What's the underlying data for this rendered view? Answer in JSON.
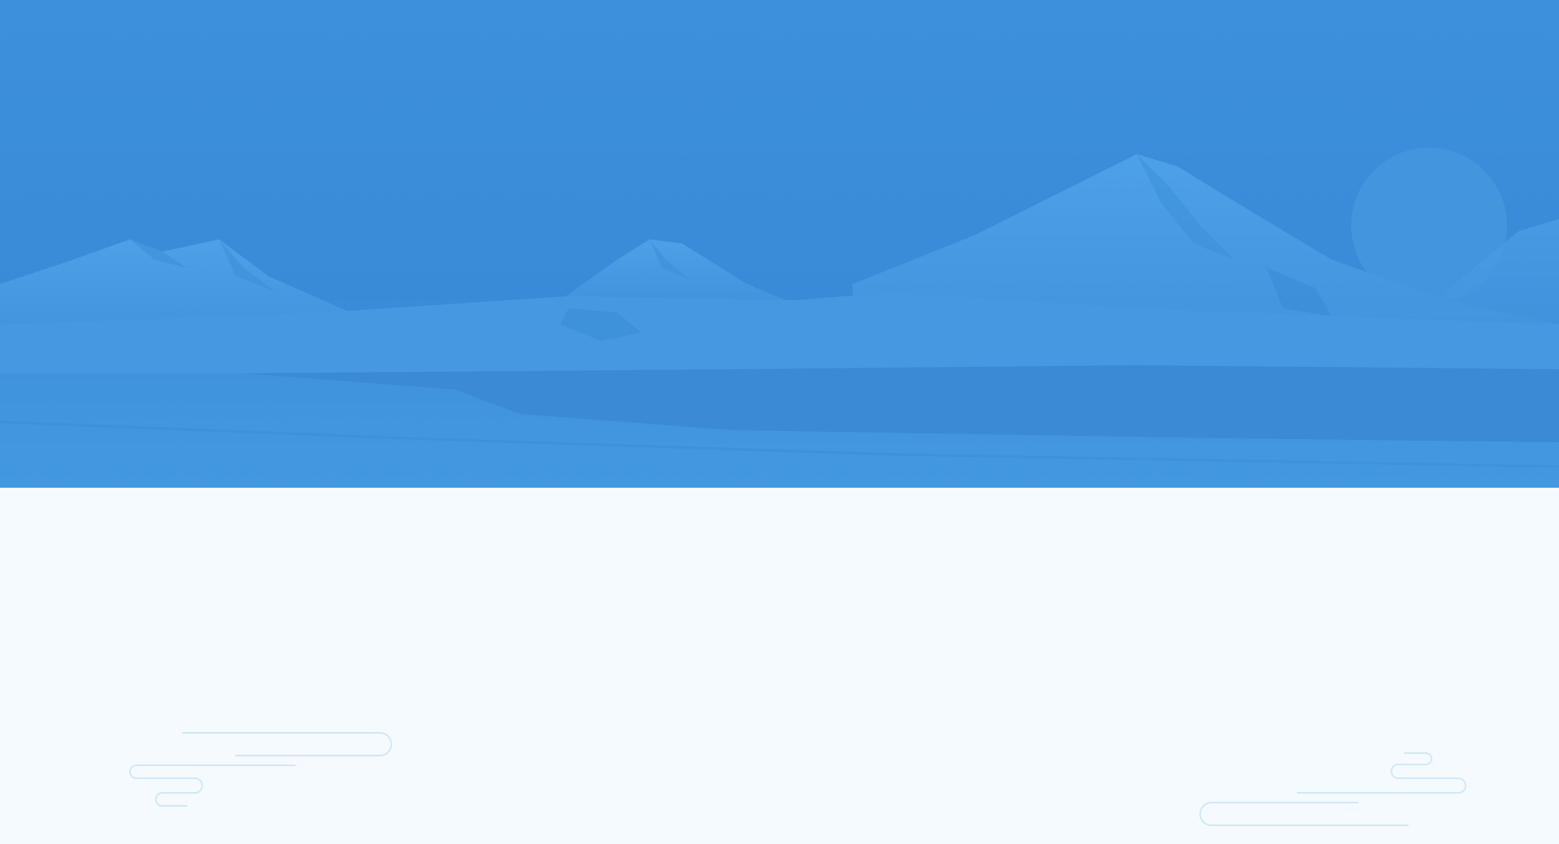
{
  "colors": {
    "sky": "#3b8edb",
    "sky_light": "#4196df",
    "snow": "#4a9de3",
    "water": "#3a8bd8",
    "sun": "#4597dd",
    "background": "#f5fafe",
    "cloud_stroke": "#cfe9f6"
  },
  "icons": {
    "left_cloud": "cloud-outline-icon",
    "right_cloud": "cloud-outline-icon"
  }
}
